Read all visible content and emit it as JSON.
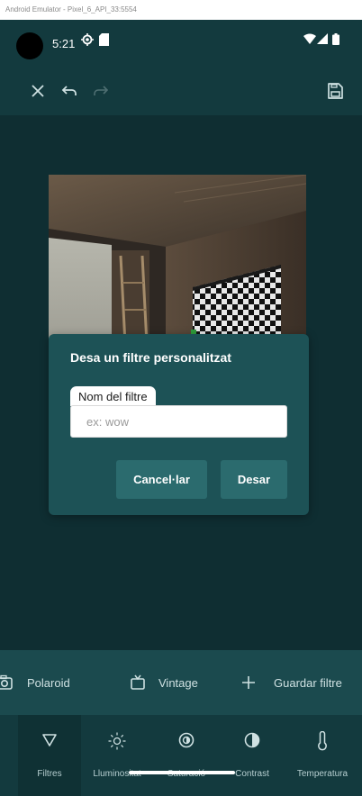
{
  "emulator": {
    "title": "Android Emulator - Pixel_6_API_33:5554"
  },
  "status_bar": {
    "time": "5:21"
  },
  "dialog": {
    "title": "Desa un filtre personalitzat",
    "field_label": "Nom del filtre",
    "field_value": "",
    "field_placeholder": "ex: wow",
    "cancel_label": "Cancel·lar",
    "save_label": "Desar"
  },
  "filter_options": [
    {
      "label": "Polaroid",
      "icon": "camera-icon"
    },
    {
      "label": "Vintage",
      "icon": "tv-icon"
    },
    {
      "label": "Guardar filtre",
      "icon": "plus-icon"
    }
  ],
  "bottom_nav": [
    {
      "label": "Filtres",
      "icon": "filter-icon",
      "active": true
    },
    {
      "label": "Lluminositat",
      "icon": "sun-icon",
      "active": false
    },
    {
      "label": "Saturació",
      "icon": "saturation-icon",
      "active": false
    },
    {
      "label": "Contrast",
      "icon": "contrast-icon",
      "active": false
    },
    {
      "label": "Temperatura",
      "icon": "thermometer-icon",
      "active": false
    }
  ],
  "colors": {
    "background": "#0f2e32",
    "toolbar": "#133a3e",
    "dialog": "#1d5256",
    "button": "#2b6b6e",
    "options_bar": "#1b4a4e"
  }
}
